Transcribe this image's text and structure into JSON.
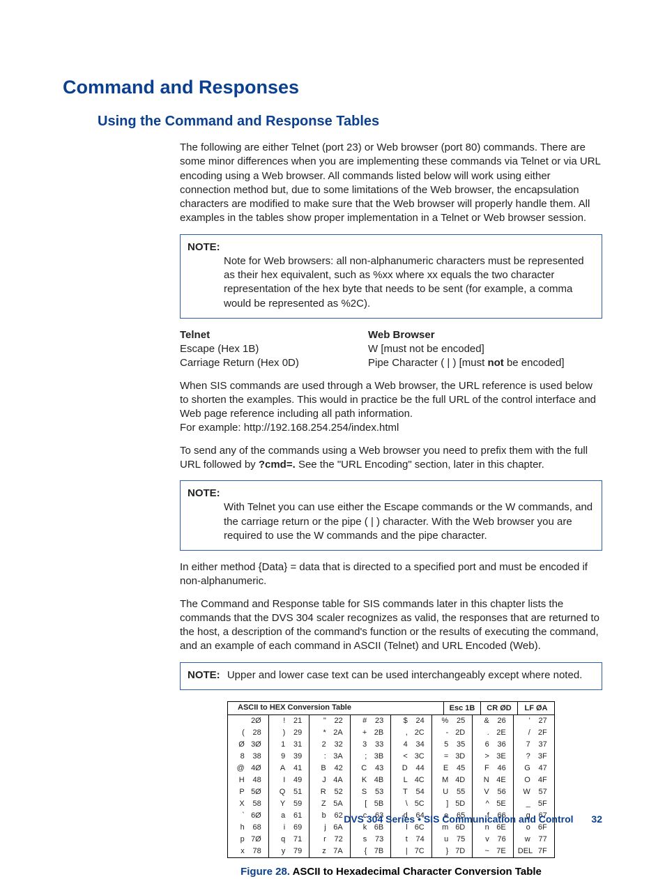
{
  "h1": "Command and Responses",
  "h2": "Using the Command and Response Tables",
  "para1": "The following are either Telnet (port 23) or Web browser (port 80) commands. There are some minor differences when you are implementing these commands via Telnet or via URL encoding using a Web browser. All commands listed below will work using either connection method but, due to some limitations of the Web browser, the encapsulation characters are modified to make sure that the Web browser will properly handle them. All examples in the tables show proper implementation in a Telnet or Web browser session.",
  "note1_prefix": "NOTE:",
  "note1_text": "Note for Web browsers: all non-alphanumeric characters must be represented as their hex equivalent, such as %xx where xx equals the two character representation of the hex byte that needs to be sent (for example, a comma would be represented as %2C).",
  "telnet": {
    "head": "Telnet",
    "l1": "Escape (Hex 1B)",
    "l2": "Carriage Return (Hex 0D)"
  },
  "web": {
    "head": "Web Browser",
    "l1": "W [must not be encoded]",
    "l2a": "Pipe Character ( | ) [must ",
    "l2b": "not",
    "l2c": " be encoded]"
  },
  "para2": "When SIS commands are used through a Web browser, the URL reference is used below to shorten the examples. This would in practice be the full URL of the control interface and Web page reference including all path information.",
  "para2b": "For example: http://192.168.254.254/index.html",
  "para3a": "To send any of the commands using a Web browser you need to prefix them with the full URL followed by ",
  "para3b": "?cmd=.",
  "para3c": " See the \"URL Encoding\" section, later in this chapter.",
  "note2_prefix": "NOTE:",
  "note2_text": "With Telnet you can use either the Escape commands or the W commands, and the carriage return or the pipe ( | ) character. With the Web browser you are required to use the W commands and the pipe character.",
  "para4": "In either method {Data} = data that is directed to a specified port and must be encoded if non-alphanumeric.",
  "para5": "The Command and Response table for SIS commands later in this chapter lists the commands that the DVS 304 scaler recognizes as valid, the responses that are returned to the host, a description of the command's function or the results of executing the command, and an example of each command in ASCII (Telnet) and URL Encoded (Web).",
  "note3_prefix": "NOTE:",
  "note3_text": "Upper and lower case text can be used interchangeably except where noted.",
  "chart_data": {
    "type": "table",
    "title": "ASCII to HEX  Conversion Table",
    "specials": [
      {
        "label": "Esc",
        "hex": "1B"
      },
      {
        "label": "CR",
        "hex": "ØD"
      },
      {
        "label": "LF",
        "hex": "ØA"
      }
    ],
    "rows": [
      [
        {
          "ch": " ",
          "hex": "2Ø"
        },
        {
          "ch": "!",
          "hex": "21"
        },
        {
          "ch": "\"",
          "hex": "22"
        },
        {
          "ch": "#",
          "hex": "23"
        },
        {
          "ch": "$",
          "hex": "24"
        },
        {
          "ch": "%",
          "hex": "25"
        },
        {
          "ch": "&",
          "hex": "26"
        },
        {
          "ch": "'",
          "hex": "27"
        }
      ],
      [
        {
          "ch": "(",
          "hex": "28"
        },
        {
          "ch": ")",
          "hex": "29"
        },
        {
          "ch": "*",
          "hex": "2A"
        },
        {
          "ch": "+",
          "hex": "2B"
        },
        {
          "ch": ",",
          "hex": "2C"
        },
        {
          "ch": "-",
          "hex": "2D"
        },
        {
          "ch": ".",
          "hex": "2E"
        },
        {
          "ch": "/",
          "hex": "2F"
        }
      ],
      [
        {
          "ch": "Ø",
          "hex": "3Ø"
        },
        {
          "ch": "1",
          "hex": "31"
        },
        {
          "ch": "2",
          "hex": "32"
        },
        {
          "ch": "3",
          "hex": "33"
        },
        {
          "ch": "4",
          "hex": "34"
        },
        {
          "ch": "5",
          "hex": "35"
        },
        {
          "ch": "6",
          "hex": "36"
        },
        {
          "ch": "7",
          "hex": "37"
        }
      ],
      [
        {
          "ch": "8",
          "hex": "38"
        },
        {
          "ch": "9",
          "hex": "39"
        },
        {
          "ch": ":",
          "hex": "3A"
        },
        {
          "ch": ";",
          "hex": "3B"
        },
        {
          "ch": "<",
          "hex": "3C"
        },
        {
          "ch": "=",
          "hex": "3D"
        },
        {
          "ch": ">",
          "hex": "3E"
        },
        {
          "ch": "?",
          "hex": "3F"
        }
      ],
      [
        {
          "ch": "@",
          "hex": "4Ø"
        },
        {
          "ch": "A",
          "hex": "41"
        },
        {
          "ch": "B",
          "hex": "42"
        },
        {
          "ch": "C",
          "hex": "43"
        },
        {
          "ch": "D",
          "hex": "44"
        },
        {
          "ch": "E",
          "hex": "45"
        },
        {
          "ch": "F",
          "hex": "46"
        },
        {
          "ch": "G",
          "hex": "47"
        }
      ],
      [
        {
          "ch": "H",
          "hex": "48"
        },
        {
          "ch": "I",
          "hex": "49"
        },
        {
          "ch": "J",
          "hex": "4A"
        },
        {
          "ch": "K",
          "hex": "4B"
        },
        {
          "ch": "L",
          "hex": "4C"
        },
        {
          "ch": "M",
          "hex": "4D"
        },
        {
          "ch": "N",
          "hex": "4E"
        },
        {
          "ch": "O",
          "hex": "4F"
        }
      ],
      [
        {
          "ch": "P",
          "hex": "5Ø"
        },
        {
          "ch": "Q",
          "hex": "51"
        },
        {
          "ch": "R",
          "hex": "52"
        },
        {
          "ch": "S",
          "hex": "53"
        },
        {
          "ch": "T",
          "hex": "54"
        },
        {
          "ch": "U",
          "hex": "55"
        },
        {
          "ch": "V",
          "hex": "56"
        },
        {
          "ch": "W",
          "hex": "57"
        }
      ],
      [
        {
          "ch": "X",
          "hex": "58"
        },
        {
          "ch": "Y",
          "hex": "59"
        },
        {
          "ch": "Z",
          "hex": "5A"
        },
        {
          "ch": "[",
          "hex": "5B"
        },
        {
          "ch": "\\",
          "hex": "5C"
        },
        {
          "ch": "]",
          "hex": "5D"
        },
        {
          "ch": "^",
          "hex": "5E"
        },
        {
          "ch": "_",
          "hex": "5F"
        }
      ],
      [
        {
          "ch": "`",
          "hex": "6Ø"
        },
        {
          "ch": "a",
          "hex": "61"
        },
        {
          "ch": "b",
          "hex": "62"
        },
        {
          "ch": "c",
          "hex": "63"
        },
        {
          "ch": "d",
          "hex": "64"
        },
        {
          "ch": "e",
          "hex": "65"
        },
        {
          "ch": "f",
          "hex": "66"
        },
        {
          "ch": "g",
          "hex": "67"
        }
      ],
      [
        {
          "ch": "h",
          "hex": "68"
        },
        {
          "ch": "i",
          "hex": "69"
        },
        {
          "ch": "j",
          "hex": "6A"
        },
        {
          "ch": "k",
          "hex": "6B"
        },
        {
          "ch": "l",
          "hex": "6C"
        },
        {
          "ch": "m",
          "hex": "6D"
        },
        {
          "ch": "n",
          "hex": "6E"
        },
        {
          "ch": "o",
          "hex": "6F"
        }
      ],
      [
        {
          "ch": "p",
          "hex": "7Ø"
        },
        {
          "ch": "q",
          "hex": "71"
        },
        {
          "ch": "r",
          "hex": "72"
        },
        {
          "ch": "s",
          "hex": "73"
        },
        {
          "ch": "t",
          "hex": "74"
        },
        {
          "ch": "u",
          "hex": "75"
        },
        {
          "ch": "v",
          "hex": "76"
        },
        {
          "ch": "w",
          "hex": "77"
        }
      ],
      [
        {
          "ch": "x",
          "hex": "78"
        },
        {
          "ch": "y",
          "hex": "79"
        },
        {
          "ch": "z",
          "hex": "7A"
        },
        {
          "ch": "{",
          "hex": "7B"
        },
        {
          "ch": "|",
          "hex": "7C"
        },
        {
          "ch": "}",
          "hex": "7D"
        },
        {
          "ch": "~",
          "hex": "7E"
        },
        {
          "ch": "DEL",
          "hex": "7F"
        }
      ]
    ]
  },
  "figure": {
    "label": "Figure 28.",
    "text": " ASCII to Hexadecimal Character Conversion Table"
  },
  "footer": {
    "text": "DVS 304 Series • SIS Communication and Control",
    "page": "32"
  }
}
